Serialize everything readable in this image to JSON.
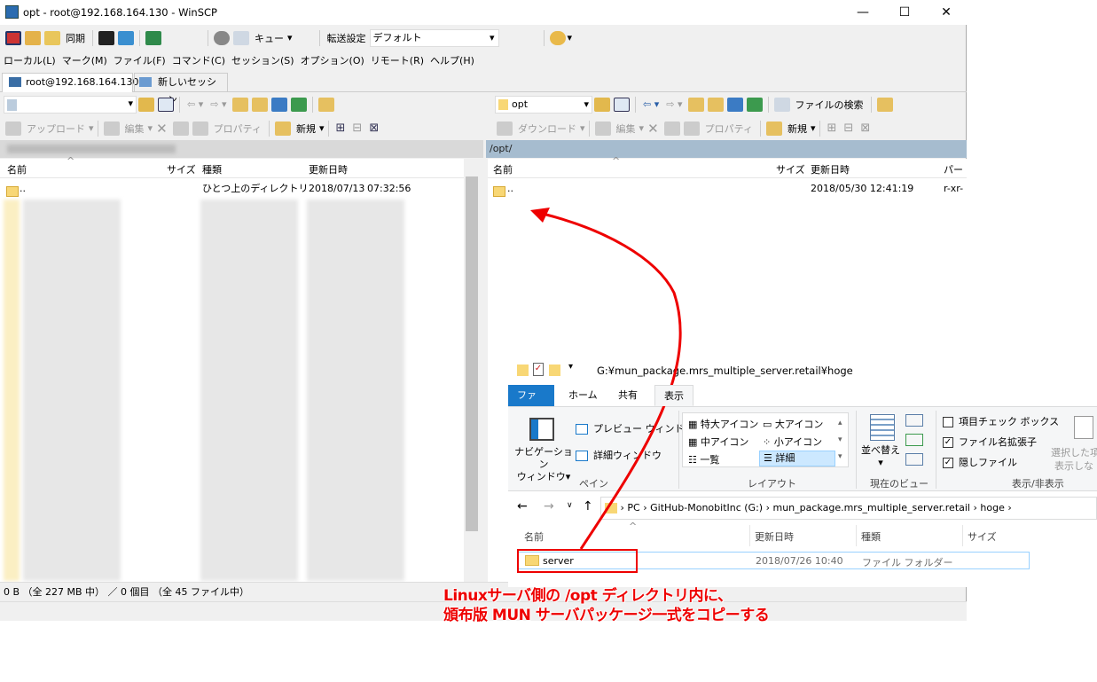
{
  "window": {
    "title": "opt - root@192.168.164.130 - WinSCP",
    "minimize": "—",
    "maximize": "☐",
    "close": "✕"
  },
  "toolbar1": {
    "sync": "同期",
    "queue": "キュー",
    "transfer_settings": "転送設定",
    "transfer_value": "デフォルト"
  },
  "menu": [
    "ローカル(L)",
    "マーク(M)",
    "ファイル(F)",
    "コマンド(C)",
    "セッション(S)",
    "オプション(O)",
    "リモート(R)",
    "ヘルプ(H)"
  ],
  "tabs": {
    "session": "root@192.168.164.130",
    "new_session": "新しいセッション"
  },
  "local": {
    "toolbar": {
      "upload": "アップロード",
      "edit": "編集",
      "properties": "プロパティ",
      "new": "新規"
    },
    "columns": {
      "name": "名前",
      "size": "サイズ",
      "type": "種類",
      "modified": "更新日時"
    },
    "parent": {
      "name": "..",
      "type": "ひとつ上のディレクトリ",
      "date": "2018/07/13",
      "time": "07:32:56"
    }
  },
  "remote": {
    "path_select": "opt",
    "find_files": "ファイルの検索",
    "toolbar": {
      "download": "ダウンロード",
      "edit": "編集",
      "properties": "プロパティ",
      "new": "新規"
    },
    "path": "/opt/",
    "columns": {
      "name": "名前",
      "size": "サイズ",
      "modified": "更新日時",
      "perm": "パーミ"
    },
    "parent": {
      "name": "..",
      "modified": "2018/05/30 12:41:19",
      "perm": "r-xr-"
    }
  },
  "status": {
    "text": "0 B （全 227 MB 中） ／ 0 個目 （全 45 ファイル中）"
  },
  "explorer": {
    "title_path": "G:¥mun_package.mrs_multiple_server.retail¥hoge",
    "tabs": [
      "ファイル",
      "ホーム",
      "共有",
      "表示"
    ],
    "pane": {
      "nav": "ナビゲーション",
      "nav2": "ウィンドウ",
      "preview": "プレビュー ウィンドウ",
      "details": "詳細ウィンドウ",
      "label": "ペイン"
    },
    "layout": {
      "xl": "特大アイコン",
      "l": "大アイコン",
      "m": "中アイコン",
      "s": "小アイコン",
      "list": "一覧",
      "detail": "詳細",
      "label": "レイアウト"
    },
    "view": {
      "sort": "並べ替え",
      "label": "現在のビュー"
    },
    "show": {
      "checkbox": "項目チェック ボックス",
      "ext": "ファイル名拡張子",
      "hidden": "隠しファイル",
      "label": "表示/非表示",
      "sel1": "選択した項",
      "sel2": "表示しな"
    },
    "breadcrumb": [
      "PC",
      "GitHub-MonobitInc (G:)",
      "mun_package.mrs_multiple_server.retail",
      "hoge"
    ],
    "columns": {
      "name": "名前",
      "modified": "更新日時",
      "type": "種類",
      "size": "サイズ"
    },
    "row": {
      "name": "server",
      "modified": "2018/07/26 10:40",
      "type": "ファイル フォルダー"
    }
  },
  "annotation": {
    "line1": "Linuxサーバ側の /opt ディレクトリ内に、",
    "line2": "頒布版 MUN サーバパッケージ一式をコピーする"
  },
  "colors": {
    "accent": "#1979ca",
    "annotation": "#e00000",
    "path_bar": "#a6bccf"
  }
}
